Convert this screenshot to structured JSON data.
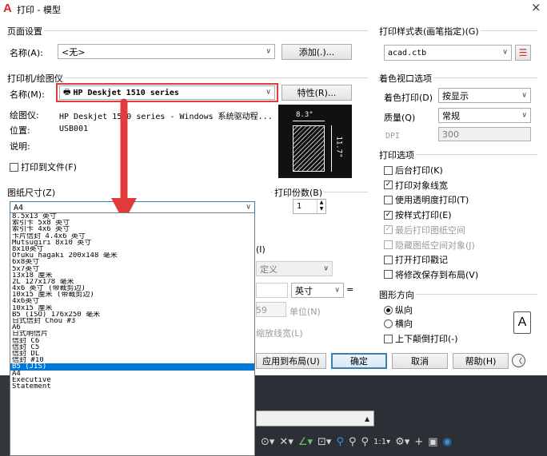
{
  "window": {
    "title": "打印 - 模型",
    "close": "×"
  },
  "page_setup": {
    "group": "页面设置",
    "name_label": "名称(A):",
    "name_value": "<无>",
    "add_button": "添加(.)..."
  },
  "printer": {
    "group": "打印机/绘图仪",
    "name_label": "名称(M):",
    "name_value": "HP Deskjet 1510 series",
    "properties_button": "特性(R)...",
    "plotter_label": "绘图仪:",
    "plotter_value": "HP Deskjet 1510 series - Windows 系统驱动程...",
    "location_label": "位置:",
    "location_value": "USB001",
    "desc_label": "说明:",
    "print_to_file": "打印到文件(F)",
    "preview_width": "8.3\"",
    "preview_height": "11.7\""
  },
  "paper_size": {
    "group": "图纸尺寸(Z)",
    "value": "A4",
    "options": [
      "8.5x13 英寸",
      "索引卡 5x8 英寸",
      "索引卡 4x6 英寸",
      "卡片信封 4.4x6 英寸",
      "Mutsugiri 8x10 英寸",
      "8x10英寸",
      "Ofuku hagaki 200x148 毫米",
      "6x8英寸",
      "5x7英寸",
      "13x18 厘米",
      "2L 127x178 毫米",
      "4x6 英寸 (带裁剪边)",
      "10x15 厘米 (带裁剪边)",
      "4x6英寸",
      "10x15 厘米",
      "B5 (ISO) 176x250 毫米",
      "日式信封 Chou #3",
      "A6",
      "日式明信片",
      "信封 C6",
      "信封 C5",
      "信封 DL",
      "信封 #10",
      "B5 (JIS)",
      "A4",
      "Executive",
      "Statement"
    ],
    "selected_index": 23
  },
  "copies": {
    "label": "打印份数(B)",
    "value": "1"
  },
  "hidden_area": {
    "partial_i": "(I)",
    "fit_value": "定义",
    "unit": "英寸",
    "equals": "=",
    "scale_value": "59",
    "unit_label": "单位(N)",
    "scale_lineweights": "缩放线宽(L)"
  },
  "plot_style": {
    "group": "打印样式表(画笔指定)(G)",
    "value": "acad.ctb"
  },
  "shaded_viewport": {
    "group": "着色视口选项",
    "shade_label": "着色打印(D)",
    "shade_value": "按显示",
    "quality_label": "质量(Q)",
    "quality_value": "常规",
    "dpi_label": "DPI",
    "dpi_value": "300"
  },
  "plot_options": {
    "group": "打印选项",
    "items": [
      {
        "label": "后台打印(K)",
        "checked": "",
        "disabled": false
      },
      {
        "label": "打印对象线宽",
        "checked": "✓",
        "disabled": false
      },
      {
        "label": "使用透明度打印(T)",
        "checked": "",
        "disabled": false
      },
      {
        "label": "按样式打印(E)",
        "checked": "✓",
        "disabled": false
      },
      {
        "label": "最后打印图纸空间",
        "checked": "✓",
        "disabled": true
      },
      {
        "label": "隐藏图纸空间对象(J)",
        "checked": "",
        "disabled": true
      },
      {
        "label": "打开打印戳记",
        "checked": "",
        "disabled": false
      },
      {
        "label": "将修改保存到布局(V)",
        "checked": "",
        "disabled": false
      }
    ]
  },
  "orientation": {
    "group": "图形方向",
    "portrait": "纵向",
    "landscape": "横向",
    "upside_down": "上下颠倒打印(-)",
    "glyph": "A"
  },
  "buttons": {
    "apply": "应用到布局(U)",
    "ok": "确定",
    "cancel": "取消",
    "help": "帮助(H)",
    "more": "〈"
  },
  "colors": {
    "highlight": "#e23b3b",
    "selection": "#0078d7",
    "autocad_red": "#d9242b"
  }
}
